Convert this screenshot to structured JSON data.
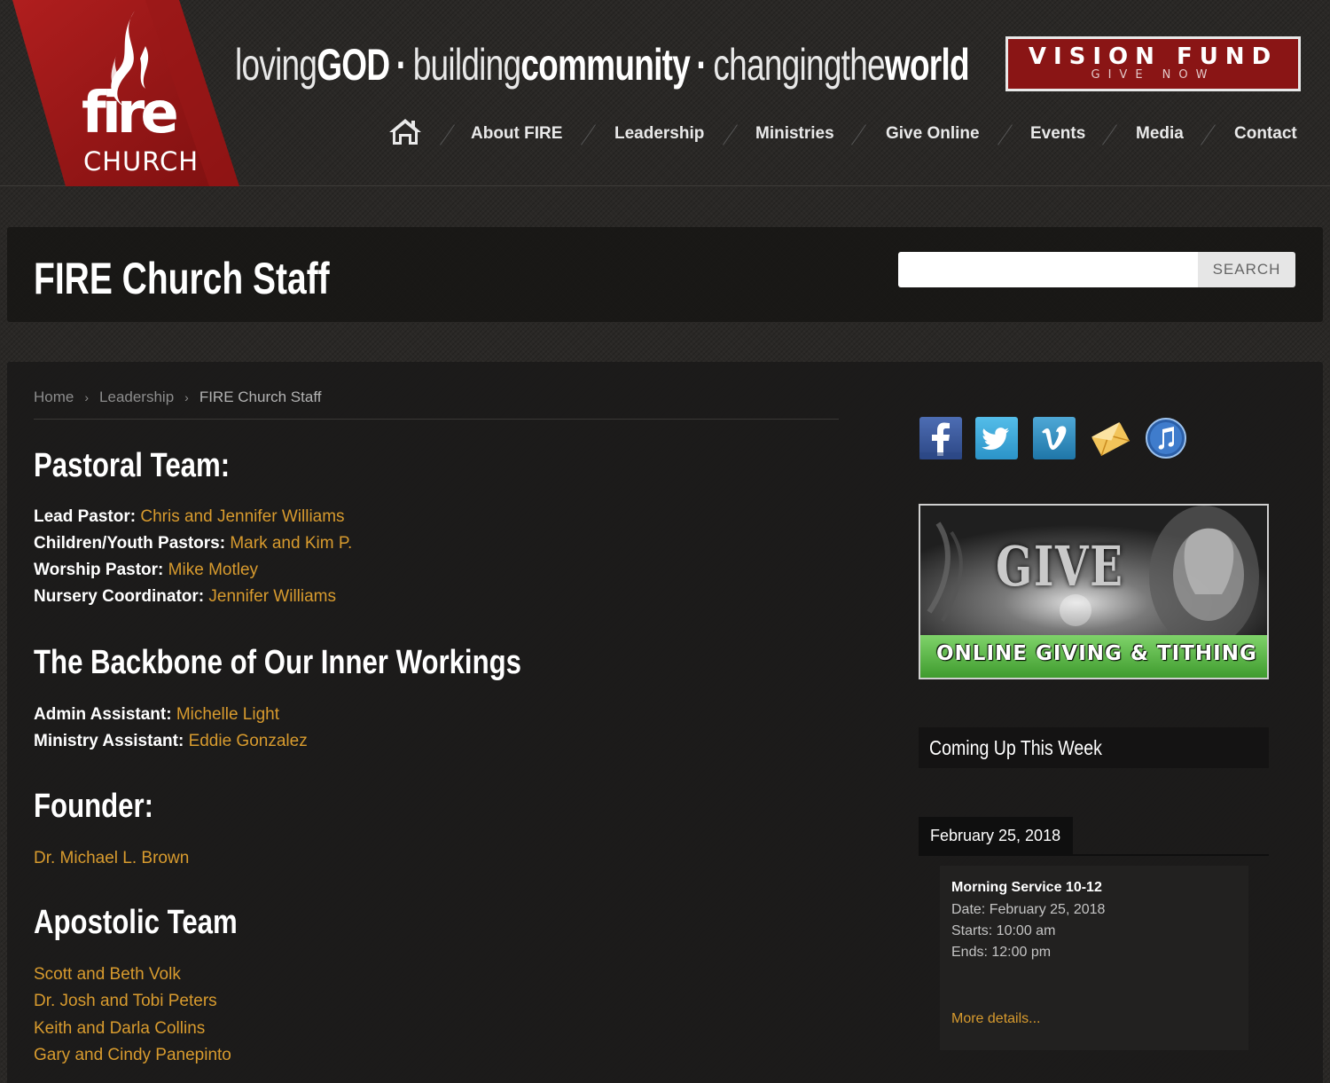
{
  "header": {
    "logo": {
      "word": "fire",
      "sub": "CHURCH"
    },
    "tagline": {
      "part1_light": "loving",
      "part1_bold": "GOD",
      "part2_light": "building",
      "part2_bold": "community",
      "part3_light": "changingthe",
      "part3_bold": "world",
      "separator": "·"
    },
    "vision": {
      "title": "VISION FUND",
      "sub": "GIVE NOW"
    },
    "nav": [
      {
        "label": "About FIRE"
      },
      {
        "label": "Leadership"
      },
      {
        "label": "Ministries"
      },
      {
        "label": "Give Online"
      },
      {
        "label": "Events"
      },
      {
        "label": "Media"
      },
      {
        "label": "Contact"
      }
    ]
  },
  "titlebar": {
    "title": "FIRE Church Staff",
    "search_button": "SEARCH",
    "search_value": ""
  },
  "breadcrumb": {
    "items": [
      "Home",
      "Leadership",
      "FIRE Church Staff"
    ],
    "separator": "›"
  },
  "sections": {
    "pastoral": {
      "heading": "Pastoral Team:",
      "rows": [
        {
          "label": "Lead Pastor:",
          "value": "Chris and Jennifer Williams"
        },
        {
          "label": "Children/Youth Pastors:",
          "value": "Mark and Kim P."
        },
        {
          "label": "Worship Pastor:",
          "value": "Mike Motley"
        },
        {
          "label": "Nursery Coordinator:",
          "value": "Jennifer Williams"
        }
      ]
    },
    "backbone": {
      "heading": "The Backbone of Our Inner Workings",
      "rows": [
        {
          "label": "Admin Assistant:",
          "value": "Michelle Light"
        },
        {
          "label": "Ministry Assistant:",
          "value": "Eddie Gonzalez"
        }
      ]
    },
    "founder": {
      "heading": "Founder:",
      "links": [
        "Dr. Michael L. Brown"
      ]
    },
    "apostolic": {
      "heading": "Apostolic Team",
      "links": [
        "Scott and Beth Volk",
        "Dr. Josh and Tobi Peters",
        "Keith and Darla Collins",
        "Gary and Cindy Panepinto"
      ]
    }
  },
  "sidebar": {
    "social": [
      {
        "icon": "facebook-icon",
        "glyph": "f",
        "color": "#3b5998"
      },
      {
        "icon": "twitter-icon",
        "glyph": "t",
        "color": "#2ea4d8"
      },
      {
        "icon": "vimeo-icon",
        "glyph": "v",
        "color": "#2d8cc0"
      },
      {
        "icon": "email-icon",
        "glyph": "✉",
        "color": "#e0a82e"
      },
      {
        "icon": "itunes-icon",
        "glyph": "♫",
        "color": "#2d6bb5"
      }
    ],
    "give_banner": {
      "word": "GIVE",
      "caption": "ONLINE GIVING & TITHING"
    },
    "upcoming_title": "Coming Up This Week",
    "date_tab": "February 25, 2018",
    "event": {
      "title": "Morning Service 10-12",
      "date": "Date: February 25, 2018",
      "starts": "Starts: 10:00 am",
      "ends": "Ends: 12:00 pm",
      "more": "More details..."
    }
  }
}
